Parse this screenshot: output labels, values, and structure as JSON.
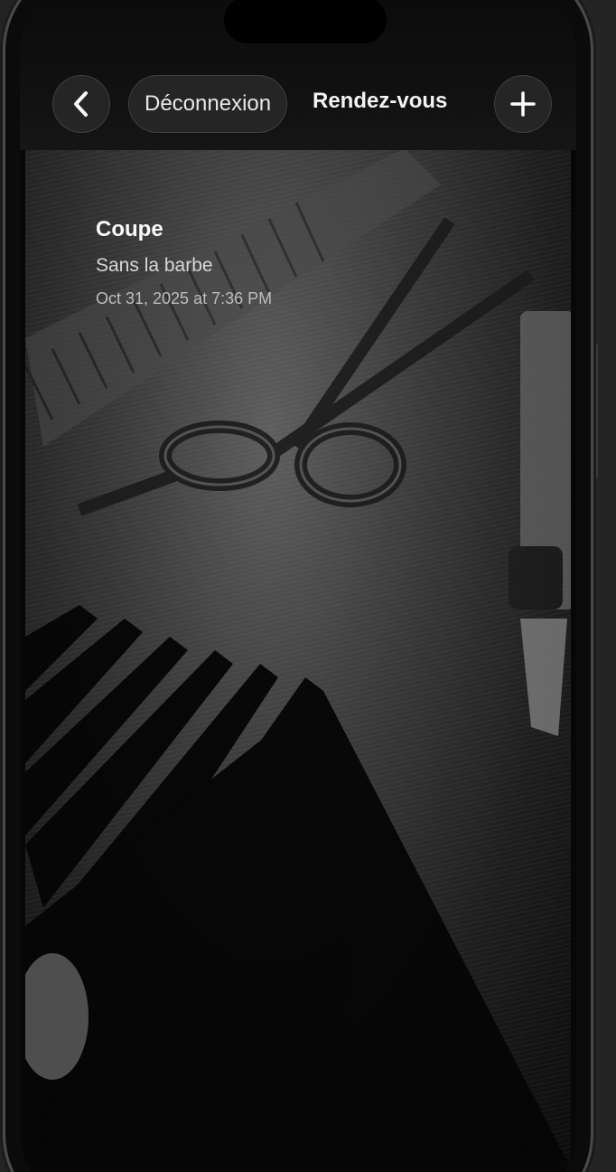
{
  "header": {
    "back_icon": "chevron-left-icon",
    "logout_label": "Déconnexion",
    "title": "Rendez-vous",
    "add_icon": "plus-icon"
  },
  "appointment": {
    "title": "Coupe",
    "subtitle": "Sans la barbe",
    "date": "Oct 31, 2025 at 7:36 PM"
  },
  "colors": {
    "screen_background": "#070707",
    "button_background": "#282828",
    "text_primary": "#f2f2f2"
  }
}
